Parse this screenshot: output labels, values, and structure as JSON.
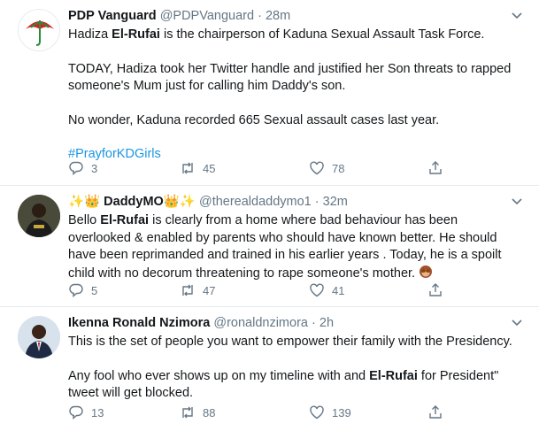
{
  "tweets": [
    {
      "name": "PDP Vanguard",
      "handle": "@PDPVanguard",
      "dot": "·",
      "time": "28m",
      "line1_name": "Hadiza ",
      "line1_hl": "El-Rufai",
      "line1_rest": " is the chairperson of Kaduna Sexual Assault Task Force.",
      "para2": "TODAY, Hadiza took her Twitter handle and justified her Son threats to rapped someone's Mum just for calling him Daddy's son.",
      "para3": "No wonder, Kaduna recorded 665 Sexual assault cases last year.",
      "hashtag": "#PrayforKDGirls",
      "replies": "3",
      "retweets": "45",
      "likes": "78"
    },
    {
      "name_prefix": "✨",
      "name_crown": "👑",
      "name": " DaddyMO",
      "name_suffix": "👑✨",
      "handle": "@therealdaddymo1",
      "dot": "·",
      "time": "32m",
      "body_pre": "Bello ",
      "body_hl": "El-Rufai",
      "body_rest": " is clearly from a home where bad behaviour has been overlooked & enabled by parents who should have known better. He should have been reprimanded and trained in his earlier years . Today, he is a spoilt child with no decorum threatening to rape someone's mother.",
      "replies": "5",
      "retweets": "47",
      "likes": "41"
    },
    {
      "name": "Ikenna Ronald Nzimora",
      "handle": "@ronaldnzimora",
      "dot": "·",
      "time": "2h",
      "para1": "This is the set of people you want to empower their family with the Presidency.",
      "para2_pre": "Any fool who ever shows up on my timeline with and ",
      "para2_hl": "El-Rufai",
      "para2_rest": " for President\" tweet will get blocked.",
      "replies": "13",
      "retweets": "88",
      "likes": "139"
    }
  ],
  "icons": {
    "reply": "reply-icon",
    "retweet": "retweet-icon",
    "like": "heart-icon",
    "share": "share-icon",
    "caret": "chevron-down-icon"
  },
  "colors": {
    "text": "#14171a",
    "secondary": "#657786",
    "link": "#1b95e0",
    "divider": "#e6ecf0",
    "pdp_red": "#e31b23",
    "pdp_green": "#1f8f3a"
  }
}
